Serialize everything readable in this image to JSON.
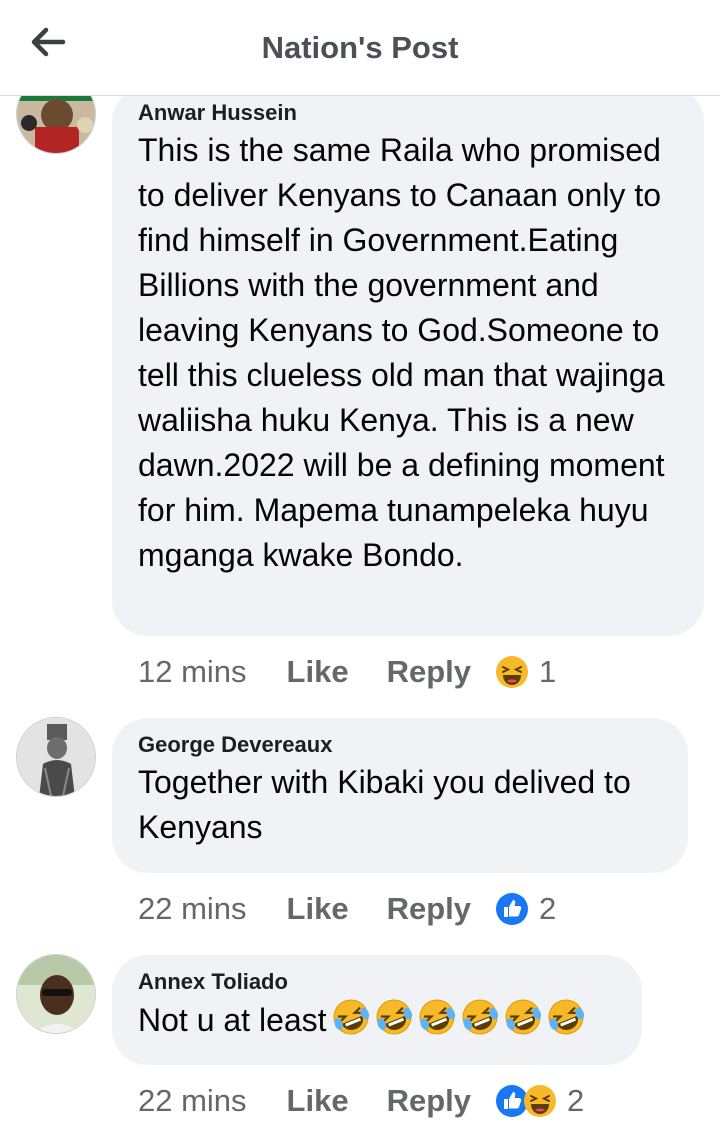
{
  "header": {
    "title": "Nation's Post",
    "back_icon": "arrow-left-icon"
  },
  "comments": [
    {
      "author": "Anwar Hussein",
      "text": "This is the same Raila who promised to deliver Kenyans to Canaan only to find himself in Government.Eating Billions with the government and leaving Kenyans to God.Someone to tell this clueless old man that wajinga waliisha huku Kenya. This is a new dawn.2022 will be a defining moment for him. Mapema tunampeleka huyu mganga kwake Bondo.",
      "time": "12 mins",
      "like": "Like",
      "reply": "Reply",
      "reactions": [
        "haha-icon"
      ],
      "reaction_count": "1"
    },
    {
      "author": "George Devereaux",
      "text": "Together with Kibaki you delived to Kenyans",
      "time": "22 mins",
      "like": "Like",
      "reply": "Reply",
      "reactions": [
        "thumbs-up-icon"
      ],
      "reaction_count": "2"
    },
    {
      "author": "Annex Toliado",
      "text": "Not u at least",
      "text_emojis": [
        "rofl-emoji",
        "rofl-emoji",
        "rofl-emoji",
        "rofl-emoji",
        "rofl-emoji",
        "rofl-emoji"
      ],
      "time": "22 mins",
      "like": "Like",
      "reply": "Reply",
      "reactions": [
        "thumbs-up-icon",
        "haha-icon"
      ],
      "reaction_count": "2"
    }
  ],
  "colors": {
    "bubble": "#f0f2f5",
    "like_blue": "#1877f2",
    "haha_yellow": "#f7b928",
    "meta_grey": "#65676b"
  }
}
